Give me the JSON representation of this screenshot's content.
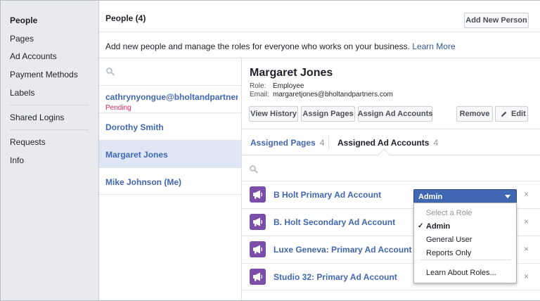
{
  "nav": {
    "items": [
      "People",
      "Pages",
      "Ad Accounts",
      "Payment Methods",
      "Labels"
    ],
    "items2": [
      "Shared Logins"
    ],
    "items3": [
      "Requests",
      "Info"
    ]
  },
  "header": {
    "title": "People (4)",
    "add_button": "Add New Person",
    "description": "Add new people and manage the roles for everyone who works on your business.",
    "learn_more": "Learn More"
  },
  "people": {
    "list": [
      {
        "name": "cathrynyongue@bholtandpartners.com",
        "status": "Pending"
      },
      {
        "name": "Dorothy Smith",
        "status": ""
      },
      {
        "name": "Margaret Jones",
        "status": ""
      },
      {
        "name": "Mike Johnson (Me)",
        "status": ""
      }
    ]
  },
  "detail": {
    "name": "Margaret Jones",
    "role_label": "Role:",
    "role_value": "Employee",
    "email_label": "Email:",
    "email_value": "margaretjones@bholtandpartners.com",
    "buttons": {
      "view_history": "View History",
      "assign_pages": "Assign Pages",
      "assign_ad_accounts": "Assign Ad Accounts",
      "remove": "Remove",
      "edit": "Edit"
    },
    "tabs": [
      {
        "label": "Assigned Pages",
        "count": "4"
      },
      {
        "label": "Assigned Ad Accounts",
        "count": "4"
      }
    ],
    "accounts": [
      {
        "name": "B Holt Primary Ad Account"
      },
      {
        "name": "B. Holt Secondary Ad Account"
      },
      {
        "name": "Luxe Geneva: Primary Ad Account"
      },
      {
        "name": "Studio 32: Primary Ad Account"
      }
    ],
    "remove_glyph": "×"
  },
  "role_dropdown": {
    "selected": "Admin",
    "options": {
      "header": "Select a Role",
      "admin": "Admin",
      "general": "General User",
      "reports": "Reports Only",
      "learn": "Learn About Roles..."
    },
    "check": "✓"
  },
  "colors": {
    "link": "#4267b2",
    "accent": "#4267b2",
    "pending": "#e0245e",
    "selected_row": "#dfe6f4",
    "account_icon": "#7b4fa9"
  },
  "icons": {
    "search": "search-icon",
    "megaphone": "megaphone-icon",
    "pencil": "pencil-icon",
    "remove": "close-icon",
    "check": "check-icon",
    "dropdown": "chevron-down-icon"
  }
}
